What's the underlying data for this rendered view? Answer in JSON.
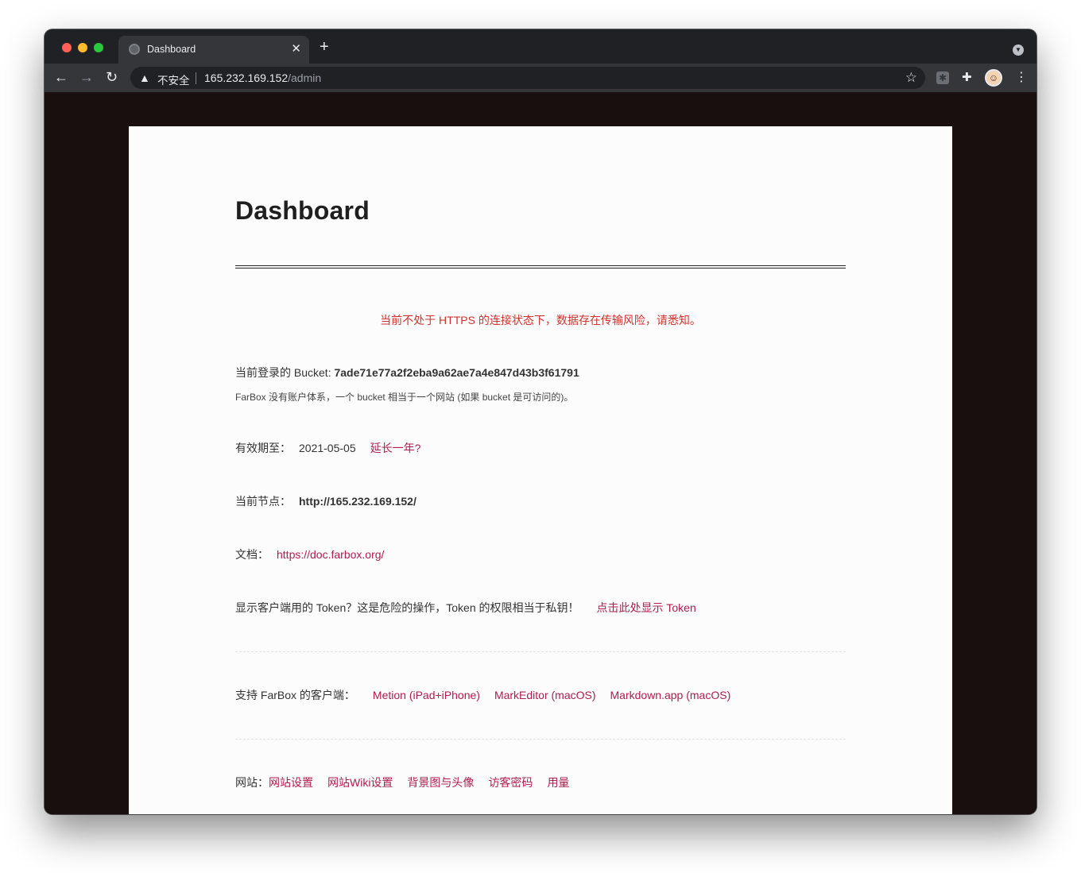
{
  "browser": {
    "tab_title": "Dashboard",
    "tab_close": "✕",
    "new_tab": "+",
    "nav": {
      "back": "←",
      "forward": "→",
      "reload": "↻"
    },
    "omnibox": {
      "warning_icon": "▲",
      "insecure_label": "不安全",
      "url_host": "165.232.169.152",
      "url_path": "/admin"
    },
    "icons": [
      "warning-icon",
      "star-icon",
      "extension-icon",
      "puzzle-icon",
      "avatar",
      "kebab-menu-icon"
    ]
  },
  "page": {
    "title": "Dashboard",
    "https_warning": "当前不处于 HTTPS 的连接状态下，数据存在传输风险，请悉知。",
    "bucket": {
      "label": "当前登录的 Bucket: ",
      "value": "7ade71e77a2f2eba9a62ae7a4e847d43b3f61791",
      "note": "FarBox 没有账户体系，一个 bucket 相当于一个网站 (如果 bucket 是可访问的)。"
    },
    "expiry": {
      "label": "有效期至：",
      "value": "2021-05-05",
      "extend_link": "延长一年?"
    },
    "node": {
      "label": "当前节点：",
      "value": "http://165.232.169.152/"
    },
    "docs": {
      "label": "文档：",
      "link": "https://doc.farbox.org/"
    },
    "token": {
      "text": "显示客户端用的 Token？这是危险的操作，Token 的权限相当于私钥！",
      "link": "点击此处显示 Token"
    },
    "clients": {
      "label": "支持 FarBox 的客户端：",
      "links": [
        "Metion (iPad+iPhone)",
        "MarkEditor (macOS)",
        "Markdown.app (macOS)"
      ]
    },
    "site": {
      "label": "网站：",
      "links": [
        "网站设置",
        "网站Wiki设置",
        "背景图与头像",
        "访客密码",
        "用量"
      ]
    }
  },
  "colors": {
    "warning_text": "#d0312d",
    "link": "#b01c4f",
    "page_bg": "#fcfcfc",
    "outer_bg": "#1a0f0f"
  }
}
